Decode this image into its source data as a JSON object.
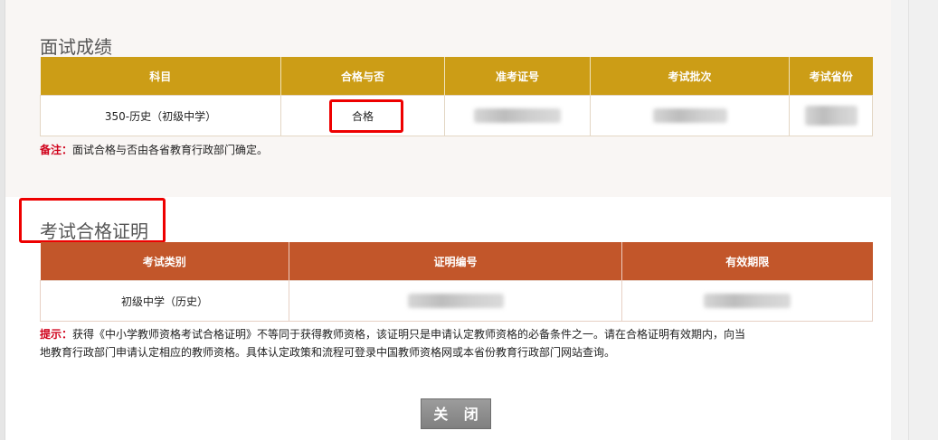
{
  "interview_section": {
    "title": "面试成绩",
    "headers": [
      "科目",
      "合格与否",
      "准考证号",
      "考试批次",
      "考试省份"
    ],
    "row": {
      "subject": "350-历史（初级中学）",
      "result": "合格"
    },
    "note_label": "备注：",
    "note_text": "面试合格与否由各省教育行政部门确定。"
  },
  "certificate_section": {
    "title": "考试合格证明",
    "headers": [
      "考试类别",
      "证明编号",
      "有效期限"
    ],
    "row": {
      "category": "初级中学（历史）"
    },
    "hint_label": "提示：",
    "hint_line1": "获得《中小学教师资格考试合格证明》不等同于获得教师资格，该证明只是申请认定教师资格的必备条件之一。请在合格证明有效期内，向当",
    "hint_line2": "地教育行政部门申请认定相应的教师资格。具体认定政策和流程可登录中国教师资格网或本省份教育行政部门网站查询。"
  },
  "close_button": "关 闭",
  "colors": {
    "gold_header": "#cc9d16",
    "rust_header": "#c2562a",
    "highlight": "#ee0000",
    "note_label": "#d0021b"
  }
}
